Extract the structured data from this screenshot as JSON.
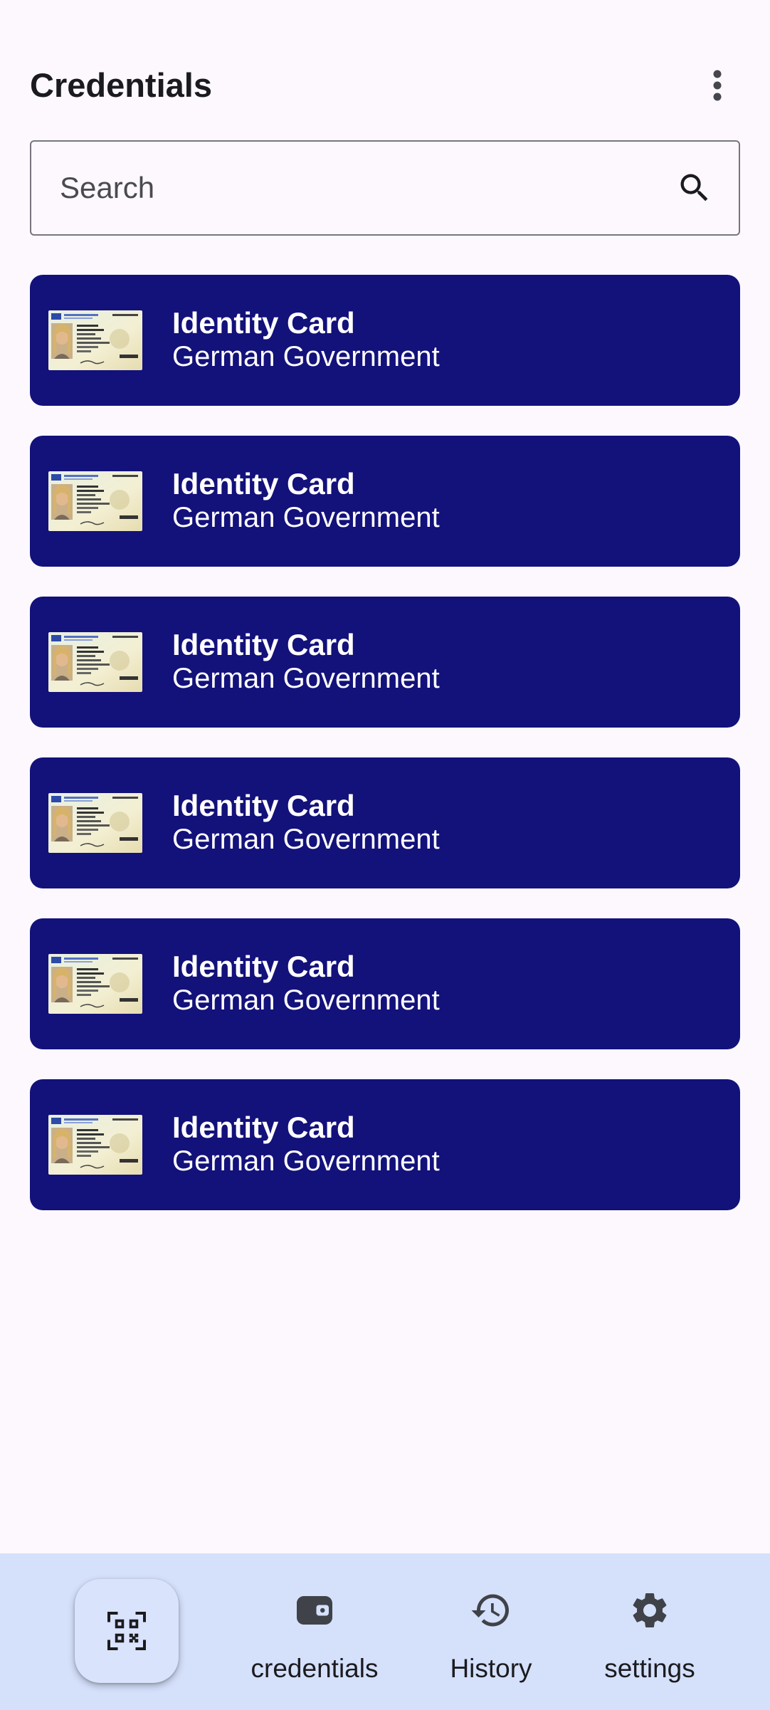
{
  "header": {
    "title": "Credentials",
    "menu_icon": "more-vert-icon"
  },
  "search": {
    "placeholder": "Search",
    "value": "",
    "icon": "search-icon"
  },
  "credentials": [
    {
      "title": "Identity Card",
      "issuer": "German Government",
      "thumbnail": "id-card-thumbnail"
    },
    {
      "title": "Identity Card",
      "issuer": "German Government",
      "thumbnail": "id-card-thumbnail"
    },
    {
      "title": "Identity Card",
      "issuer": "German Government",
      "thumbnail": "id-card-thumbnail"
    },
    {
      "title": "Identity Card",
      "issuer": "German Government",
      "thumbnail": "id-card-thumbnail"
    },
    {
      "title": "Identity Card",
      "issuer": "German Government",
      "thumbnail": "id-card-thumbnail"
    },
    {
      "title": "Identity Card",
      "issuer": "German Government",
      "thumbnail": "id-card-thumbnail"
    }
  ],
  "bottom_nav": {
    "fab_icon": "qr-scan-icon",
    "items": [
      {
        "label": "credentials",
        "icon": "wallet-icon"
      },
      {
        "label": "History",
        "icon": "history-icon"
      },
      {
        "label": "settings",
        "icon": "gear-icon"
      }
    ]
  },
  "colors": {
    "background": "#fcf8fd",
    "card": "#13117a",
    "nav_bar": "#d5e0fb",
    "text": "#1b1b1f"
  }
}
